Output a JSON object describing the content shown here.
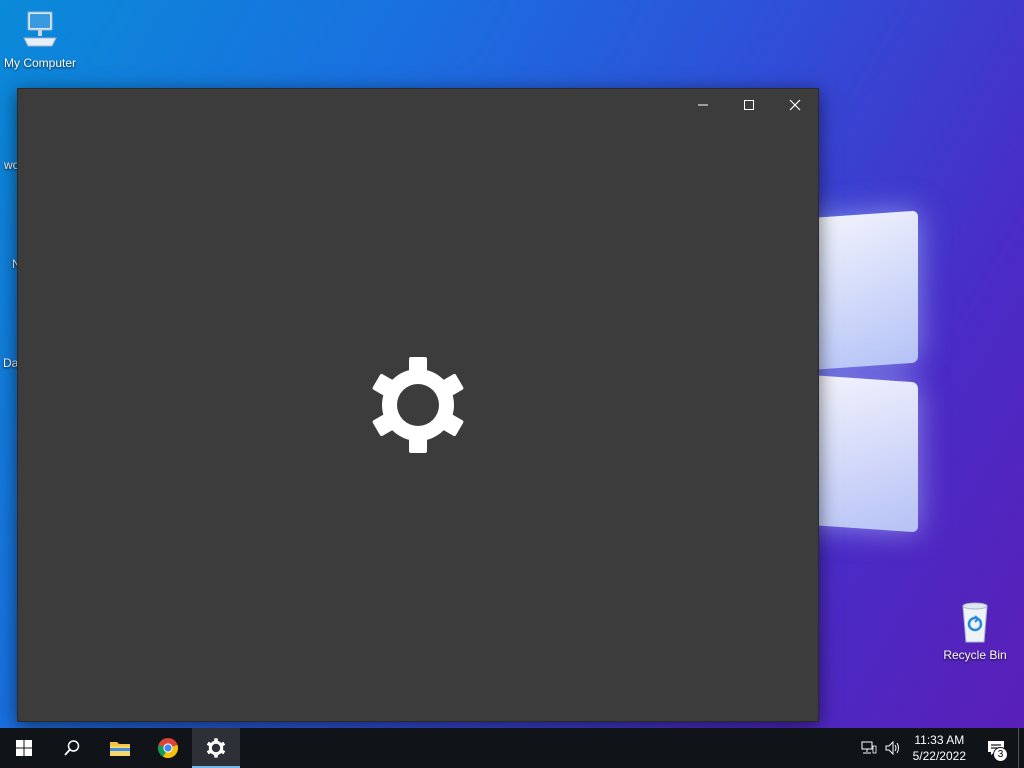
{
  "desktop": {
    "icons": [
      {
        "label": "My Computer",
        "icon": "computer-icon"
      },
      {
        "label": "Recycle Bin",
        "icon": "recycle-bin-icon"
      }
    ],
    "partial_labels": [
      "wo",
      "N",
      "Da"
    ]
  },
  "window": {
    "title": "",
    "controls": {
      "minimize": "minimize-icon",
      "maximize": "maximize-icon",
      "close": "close-icon"
    },
    "splash_icon": "gear-icon",
    "background_color": "#3c3c3c"
  },
  "taskbar": {
    "buttons": [
      {
        "name": "start-button",
        "icon": "windows-logo-icon"
      },
      {
        "name": "search-button",
        "icon": "search-icon"
      },
      {
        "name": "file-explorer-button",
        "icon": "folder-icon"
      },
      {
        "name": "chrome-button",
        "icon": "chrome-icon"
      },
      {
        "name": "settings-button",
        "icon": "gear-icon",
        "active": true
      }
    ],
    "tray": {
      "network_icon": "network-icon",
      "volume_icon": "volume-icon",
      "time": "11:33 AM",
      "date": "5/22/2022",
      "notification_count": "3"
    }
  },
  "colors": {
    "accent": "#76b9ed",
    "taskbar": "#101318",
    "window": "#3c3c3c"
  }
}
